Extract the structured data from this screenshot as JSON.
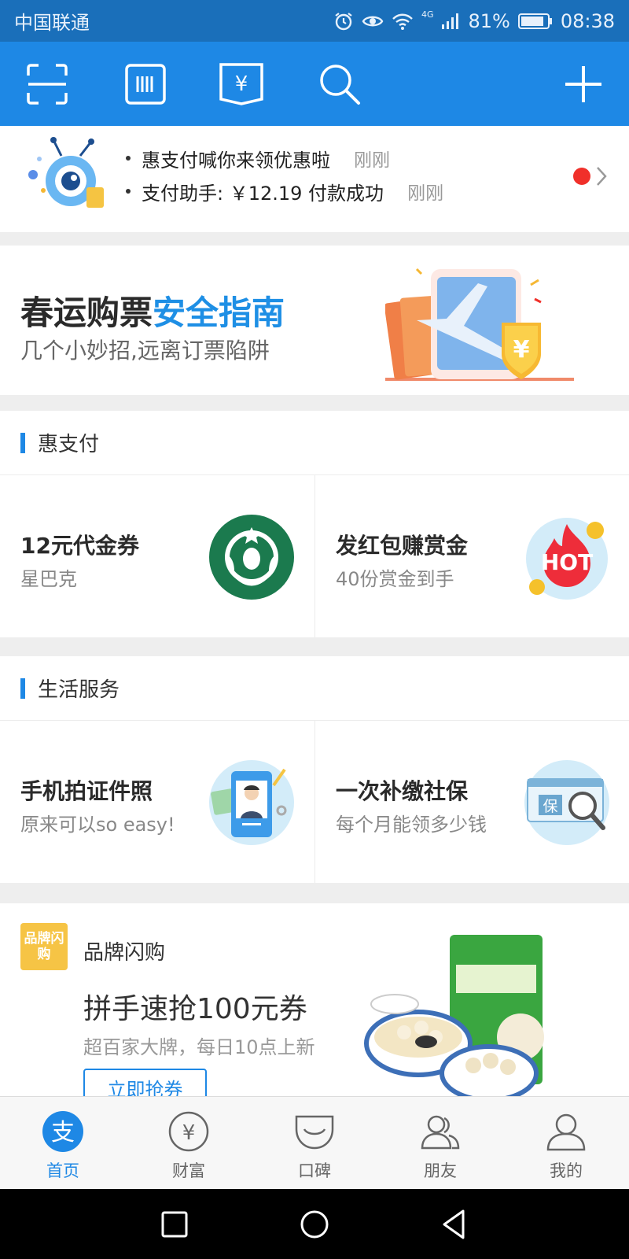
{
  "status_bar": {
    "carrier": "中国联通",
    "network": "4G",
    "battery": "81%",
    "time": "08:38"
  },
  "top_bar": {
    "icons": [
      "scan-icon",
      "barcode-icon",
      "pay-voucher-icon",
      "search-icon",
      "add-icon"
    ]
  },
  "notice": {
    "items": [
      {
        "text": "惠支付喊你来领优惠啦",
        "time": "刚刚"
      },
      {
        "text": "支付助手: ￥12.19 付款成功",
        "time": "刚刚"
      }
    ],
    "unread_dot_color": "#f0302a"
  },
  "banner": {
    "title_black": "春运购票",
    "title_blue": "安全指南",
    "subtitle": "几个小妙招,远离订票陷阱"
  },
  "hui_zhifu": {
    "header": "惠支付",
    "cards": [
      {
        "title": "12元代金券",
        "subtitle": "星巴克",
        "icon": "starbucks-logo"
      },
      {
        "title": "发红包赚赏金",
        "subtitle": "40份赏金到手",
        "icon": "hot-icon",
        "icon_text": "HOT"
      }
    ]
  },
  "life_services": {
    "header": "生活服务",
    "cards": [
      {
        "title": "手机拍证件照",
        "subtitle": "原来可以so easy!",
        "icon": "id-photo-icon"
      },
      {
        "title": "一次补缴社保",
        "subtitle": "每个月能领多少钱",
        "icon": "social-insurance-icon",
        "icon_text": "保"
      }
    ]
  },
  "brand_flash": {
    "badge": "品牌闪购",
    "title": "品牌闪购",
    "headline": "拼手速抢100元券",
    "subtitle": "超百家大牌，每日10点上新",
    "button": "立即抢券"
  },
  "tab_bar": {
    "active_index": 0,
    "accent": "#1e88e5",
    "tabs": [
      {
        "label": "首页",
        "icon": "alipay-home-icon",
        "glyph": "支"
      },
      {
        "label": "财富",
        "icon": "wealth-icon",
        "glyph": "¥"
      },
      {
        "label": "口碑",
        "icon": "koubei-icon"
      },
      {
        "label": "朋友",
        "icon": "friends-icon"
      },
      {
        "label": "我的",
        "icon": "profile-icon"
      }
    ]
  },
  "nav_bar": {
    "buttons": [
      "recent-apps-button",
      "home-button",
      "back-button"
    ]
  },
  "colors": {
    "header_blue": "#1e88e5",
    "status_blue": "#1a6fba",
    "accent_blue": "#1e8fe5"
  }
}
